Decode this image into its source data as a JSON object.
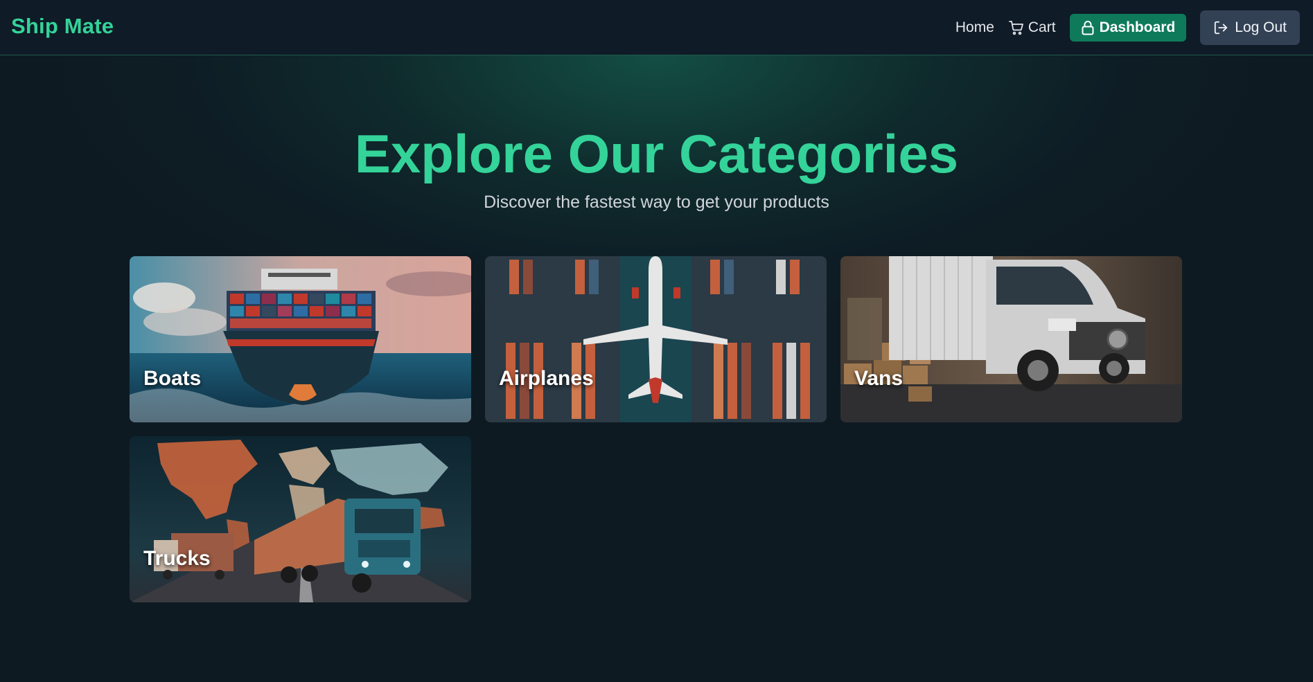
{
  "nav": {
    "brand": "Ship Mate",
    "home": "Home",
    "cart": "Cart",
    "dashboard": "Dashboard",
    "logout": "Log Out"
  },
  "hero": {
    "title": "Explore Our Categories",
    "subtitle": "Discover the fastest way to get your products"
  },
  "categories": [
    {
      "label": "Boats",
      "image": "container-ship-photo"
    },
    {
      "label": "Airplanes",
      "image": "airplane-over-containers-photo"
    },
    {
      "label": "Vans",
      "image": "delivery-van-photo"
    },
    {
      "label": "Trucks",
      "image": "trucks-world-map-photo"
    }
  ],
  "colors": {
    "accent": "#34d399",
    "dashboard_button": "#0f7a5a",
    "logout_button": "#334155",
    "navbar": "#0f1b27",
    "background": "#0e1d25"
  }
}
